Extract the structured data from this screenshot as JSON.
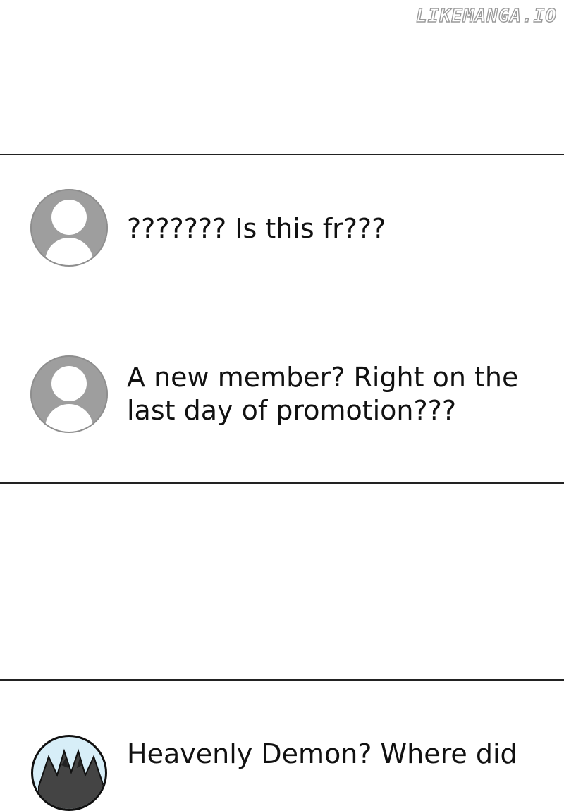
{
  "watermark": "LIKEMANGA.IO",
  "comments": [
    {
      "avatar_icon": "default-user-avatar-icon",
      "text": "??????? Is this fr???"
    },
    {
      "avatar_icon": "default-user-avatar-icon",
      "text": "A new member? Right on the last day of promotion???"
    },
    {
      "avatar_icon": "heavenly-demon-avatar-icon",
      "text": "Heavenly Demon? Where did"
    }
  ],
  "colors": {
    "background": "#ffffff",
    "divider": "#222222",
    "avatar_gray": "#9e9e9e",
    "text": "#111111",
    "watermark_outline": "#9a9a9a",
    "demon_avatar_bg": "#d7eef8"
  }
}
